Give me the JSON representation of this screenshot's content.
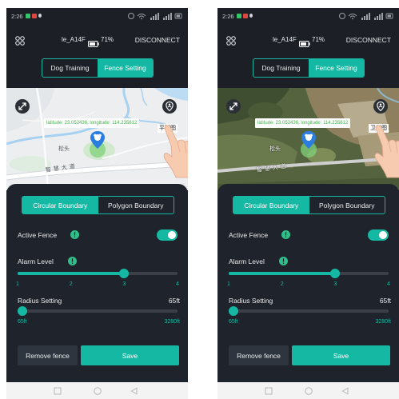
{
  "app": {
    "status": {
      "time": "2:26"
    },
    "header": {
      "device_name": "le_A14F",
      "battery_label": "71%",
      "disconnect_label": "DISCONNECT"
    },
    "mode_tabs": [
      {
        "label": "Dog Training",
        "active": false
      },
      {
        "label": "Fence Setting",
        "active": true
      }
    ],
    "map": {
      "coordinates_tooltip": "latitude: 23.052436, longitude: 114.235612",
      "place_label": "松头",
      "road_label": "智慧大道"
    },
    "boundary_tabs": [
      {
        "label": "Circular Boundary",
        "active": true
      },
      {
        "label": "Polygon Boundary",
        "active": false
      }
    ],
    "active_fence": {
      "label": "Active Fence",
      "enabled": true
    },
    "alarm_level": {
      "label": "Alarm Level",
      "value": 3,
      "min": 1,
      "max": 4,
      "ticks": [
        "1",
        "2",
        "3",
        "4"
      ]
    },
    "radius": {
      "label": "Radius Setting",
      "value_label": "65ft",
      "value": 65,
      "min": 65,
      "max": 3280,
      "min_label": "65ft",
      "max_label": "3280ft"
    },
    "buttons": {
      "remove_label": "Remove fence",
      "save_label": "Save"
    }
  },
  "screens": [
    {
      "map_view": "standard",
      "map_type_label": "平面图"
    },
    {
      "map_view": "satellite",
      "map_type_label": "卫星图"
    }
  ],
  "colors": {
    "accent": "#15b8a2",
    "background": "#1c1f26",
    "panel": "#1f232b",
    "button_secondary": "#2e353e",
    "info": "#2fbf8a"
  },
  "icons": {
    "menu": "grid-icon",
    "battery": "battery-icon",
    "expand": "expand-icon",
    "locate": "person-pin-icon",
    "info": "info-icon",
    "marker": "dog-location-marker",
    "nav": [
      "square-icon",
      "circle-icon",
      "triangle-icon"
    ]
  }
}
